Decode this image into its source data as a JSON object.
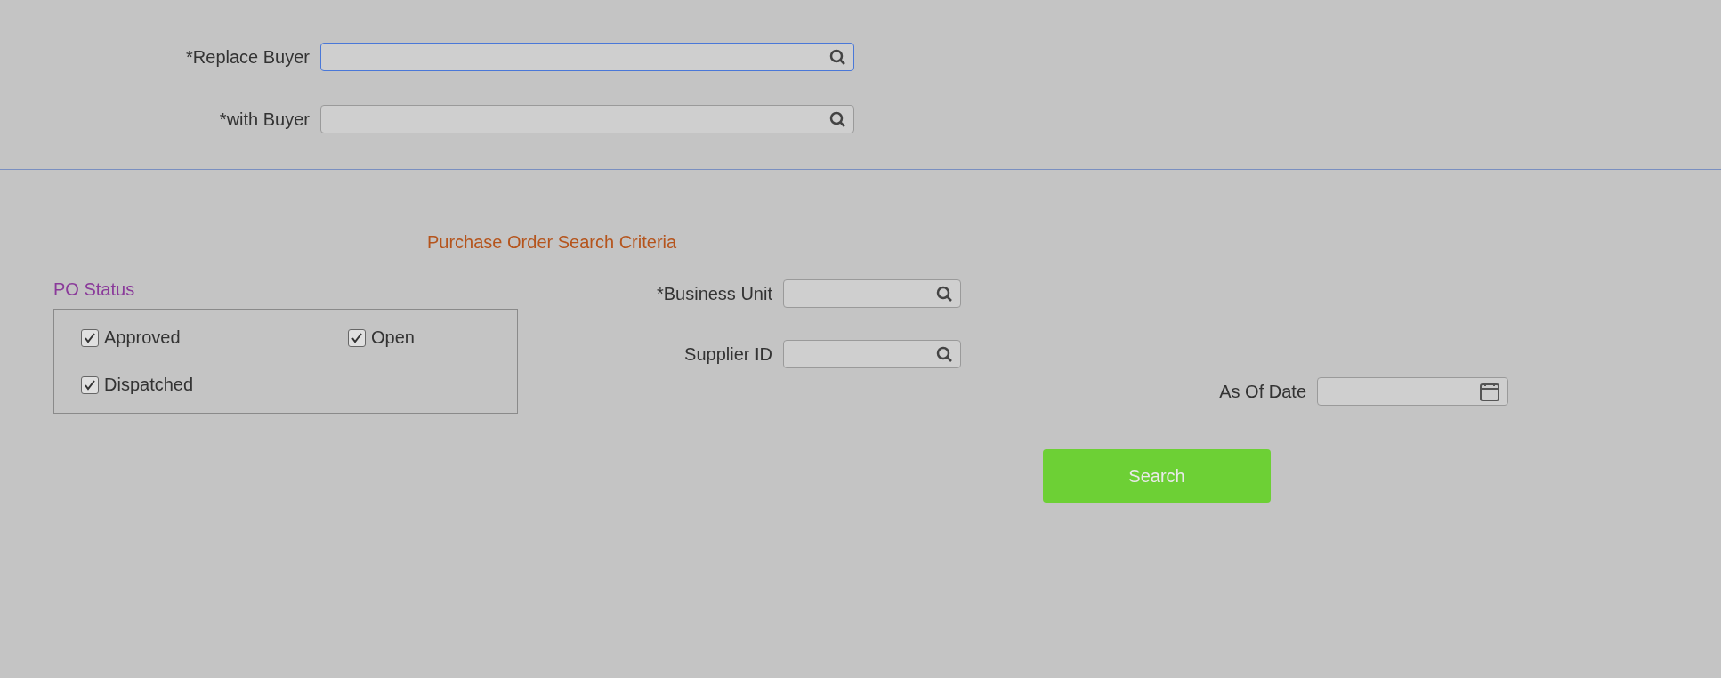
{
  "replace": {
    "label": "*Replace Buyer",
    "with_label": "*with Buyer"
  },
  "section_title": "Purchase Order Search Criteria",
  "po_status": {
    "legend": "PO Status",
    "options": [
      {
        "label": "Approved",
        "checked": true
      },
      {
        "label": "Open",
        "checked": true
      },
      {
        "label": "Dispatched",
        "checked": true
      }
    ]
  },
  "fields": [
    {
      "label": "*Business Unit",
      "kind": "lookup"
    },
    {
      "label": "Supplier ID",
      "kind": "lookup"
    },
    {
      "label": "As Of Date",
      "kind": "date"
    }
  ],
  "search_button": "Search"
}
